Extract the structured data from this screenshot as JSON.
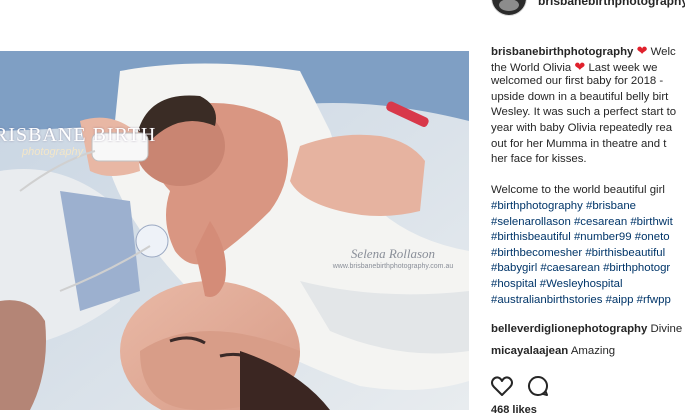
{
  "header": {
    "username": "brisbanebirthphotography"
  },
  "photo": {
    "logo_main": "RISBANE BIRTH",
    "logo_sub": "photography",
    "watermark_name": "Selena Rollason",
    "watermark_url": "www.brisbanebirthphotography.com.au"
  },
  "caption": {
    "username": "brisbanebirthphotography",
    "lines": [
      "Welc",
      "the World Olivia",
      "Last week we",
      "welcomed our first baby for 2018 -",
      "upside down in a beautiful belly birt",
      "Wesley. It was such a perfect start to",
      "year with baby Olivia repeatedly rea",
      "out for her Mumma in theatre and t",
      "her face for kisses."
    ],
    "welcome_line": "Welcome to the world beautiful girl",
    "hashtag_lines": [
      "#birthphotography #brisbane",
      "#selenarollason #cesarean #birthwit",
      "#birthisbeautiful #number99 #oneto",
      "#birthbecomesher #birthisbeautiful",
      "#babygirl #caesarean #birthphotogr",
      "#hospital #Wesleyhospital",
      "#australianbirthstories #aipp #rfwpp"
    ]
  },
  "comments": [
    {
      "user": "belleverdiglionephotography",
      "text": "Divine"
    },
    {
      "user": "micayalaajean",
      "text": "Amazing"
    }
  ],
  "likes_text": "468 likes",
  "colors": {
    "heart": "#e0212c",
    "hashtag": "#003569",
    "text": "#262626"
  },
  "icons": {
    "like": "heart-outline-icon",
    "comment": "speech-bubble-icon"
  }
}
